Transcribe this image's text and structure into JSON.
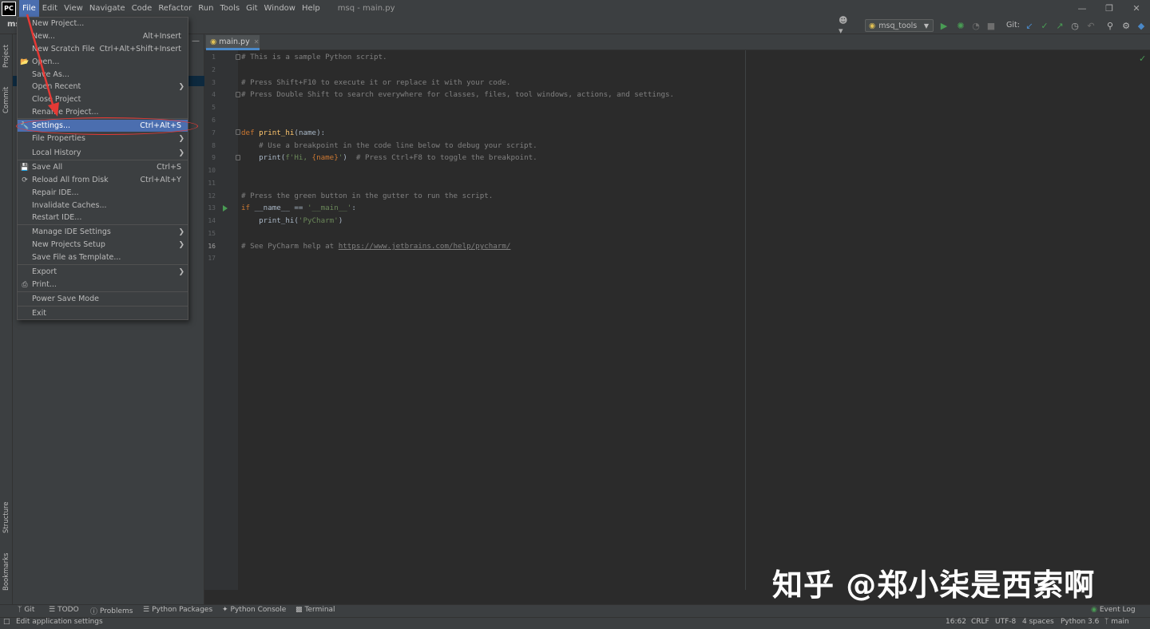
{
  "app": {
    "logo_text": "PC",
    "window_title": "msq - main.py",
    "project_name": "ms"
  },
  "menubar": {
    "items": [
      "File",
      "Edit",
      "View",
      "Navigate",
      "Code",
      "Refactor",
      "Run",
      "Tools",
      "Git",
      "Window",
      "Help"
    ],
    "active": "File"
  },
  "toolbar": {
    "run_config": "msq_tools",
    "git_label": "Git:"
  },
  "left_strip": {
    "project": "Project",
    "commit": "Commit",
    "structure": "Structure",
    "bookmarks": "Bookmarks"
  },
  "editor": {
    "tab_label": "main.py",
    "current_line": 16,
    "lines": [
      {
        "n": "1"
      },
      {
        "n": "2"
      },
      {
        "n": "3"
      },
      {
        "n": "4"
      },
      {
        "n": "5"
      },
      {
        "n": "6"
      },
      {
        "n": "7"
      },
      {
        "n": "8"
      },
      {
        "n": "9"
      },
      {
        "n": "10"
      },
      {
        "n": "11"
      },
      {
        "n": "12"
      },
      {
        "n": "13"
      },
      {
        "n": "14"
      },
      {
        "n": "15"
      },
      {
        "n": "16"
      },
      {
        "n": "17"
      }
    ],
    "code": {
      "l1": "# This is a sample Python script.",
      "l3": "# Press Shift+F10 to execute it or replace it with your code.",
      "l4": "# Press Double Shift to search everywhere for classes, files, tool windows, actions, and settings.",
      "l7_kw": "def ",
      "l7_fn": "print_hi",
      "l7_rest": "(name):",
      "l8": "    # Use a breakpoint in the code line below to debug your script.",
      "l9_a": "    print(",
      "l9_str1": "f'Hi, ",
      "l9_var": "{name}",
      "l9_str2": "'",
      "l9_b": ")  ",
      "l9_com": "# Press Ctrl+F8 to toggle the breakpoint.",
      "l12": "# Press the green button in the gutter to run the script.",
      "l13_kw": "if ",
      "l13_a": "__name__ == ",
      "l13_str": "'__main__'",
      "l13_b": ":",
      "l14_a": "    print_hi(",
      "l14_str": "'PyCharm'",
      "l14_b": ")",
      "l16_com": "# See PyCharm help at ",
      "l16_url": "https://www.jetbrains.com/help/pycharm/"
    }
  },
  "file_menu": {
    "items": [
      {
        "label": "New Project...",
        "shortcut": "",
        "submenu": false
      },
      {
        "label": "New...",
        "shortcut": "Alt+Insert",
        "submenu": false
      },
      {
        "label": "New Scratch File",
        "shortcut": "Ctrl+Alt+Shift+Insert",
        "submenu": false
      },
      {
        "label": "Open...",
        "shortcut": "",
        "submenu": false
      },
      {
        "label": "Save As...",
        "shortcut": "",
        "submenu": false
      },
      {
        "label": "Open Recent",
        "shortcut": "",
        "submenu": true
      },
      {
        "label": "Close Project",
        "shortcut": "",
        "submenu": false
      },
      {
        "label": "Rename Project...",
        "shortcut": "",
        "submenu": false
      },
      {
        "label": "Settings...",
        "shortcut": "Ctrl+Alt+S",
        "submenu": false
      },
      {
        "label": "File Properties",
        "shortcut": "",
        "submenu": true
      },
      {
        "label": "Local History",
        "shortcut": "",
        "submenu": true
      },
      {
        "label": "Save All",
        "shortcut": "Ctrl+S",
        "submenu": false
      },
      {
        "label": "Reload All from Disk",
        "shortcut": "Ctrl+Alt+Y",
        "submenu": false
      },
      {
        "label": "Repair IDE...",
        "shortcut": "",
        "submenu": false
      },
      {
        "label": "Invalidate Caches...",
        "shortcut": "",
        "submenu": false
      },
      {
        "label": "Restart IDE...",
        "shortcut": "",
        "submenu": false
      },
      {
        "label": "Manage IDE Settings",
        "shortcut": "",
        "submenu": true
      },
      {
        "label": "New Projects Setup",
        "shortcut": "",
        "submenu": true
      },
      {
        "label": "Save File as Template...",
        "shortcut": "",
        "submenu": false
      },
      {
        "label": "Export",
        "shortcut": "",
        "submenu": true
      },
      {
        "label": "Print...",
        "shortcut": "",
        "submenu": false
      },
      {
        "label": "Power Save Mode",
        "shortcut": "",
        "submenu": false
      },
      {
        "label": "Exit",
        "shortcut": "",
        "submenu": false
      }
    ],
    "selected": "Settings..."
  },
  "bottom_tabs": [
    "Git",
    "TODO",
    "Problems",
    "Python Packages",
    "Python Console",
    "Terminal",
    "Event Log"
  ],
  "status_bar": {
    "message": "Edit application settings",
    "position": "16:62",
    "line_sep": "CRLF",
    "encoding": "UTF-8",
    "indent": "4 spaces",
    "interpreter": "Python 3.6",
    "branch": "main"
  },
  "watermark": "知乎 @郑小柒是西索啊",
  "colors": {
    "accent": "#4b6eaf",
    "annotation": "#e53935",
    "run_green": "#499c54"
  }
}
